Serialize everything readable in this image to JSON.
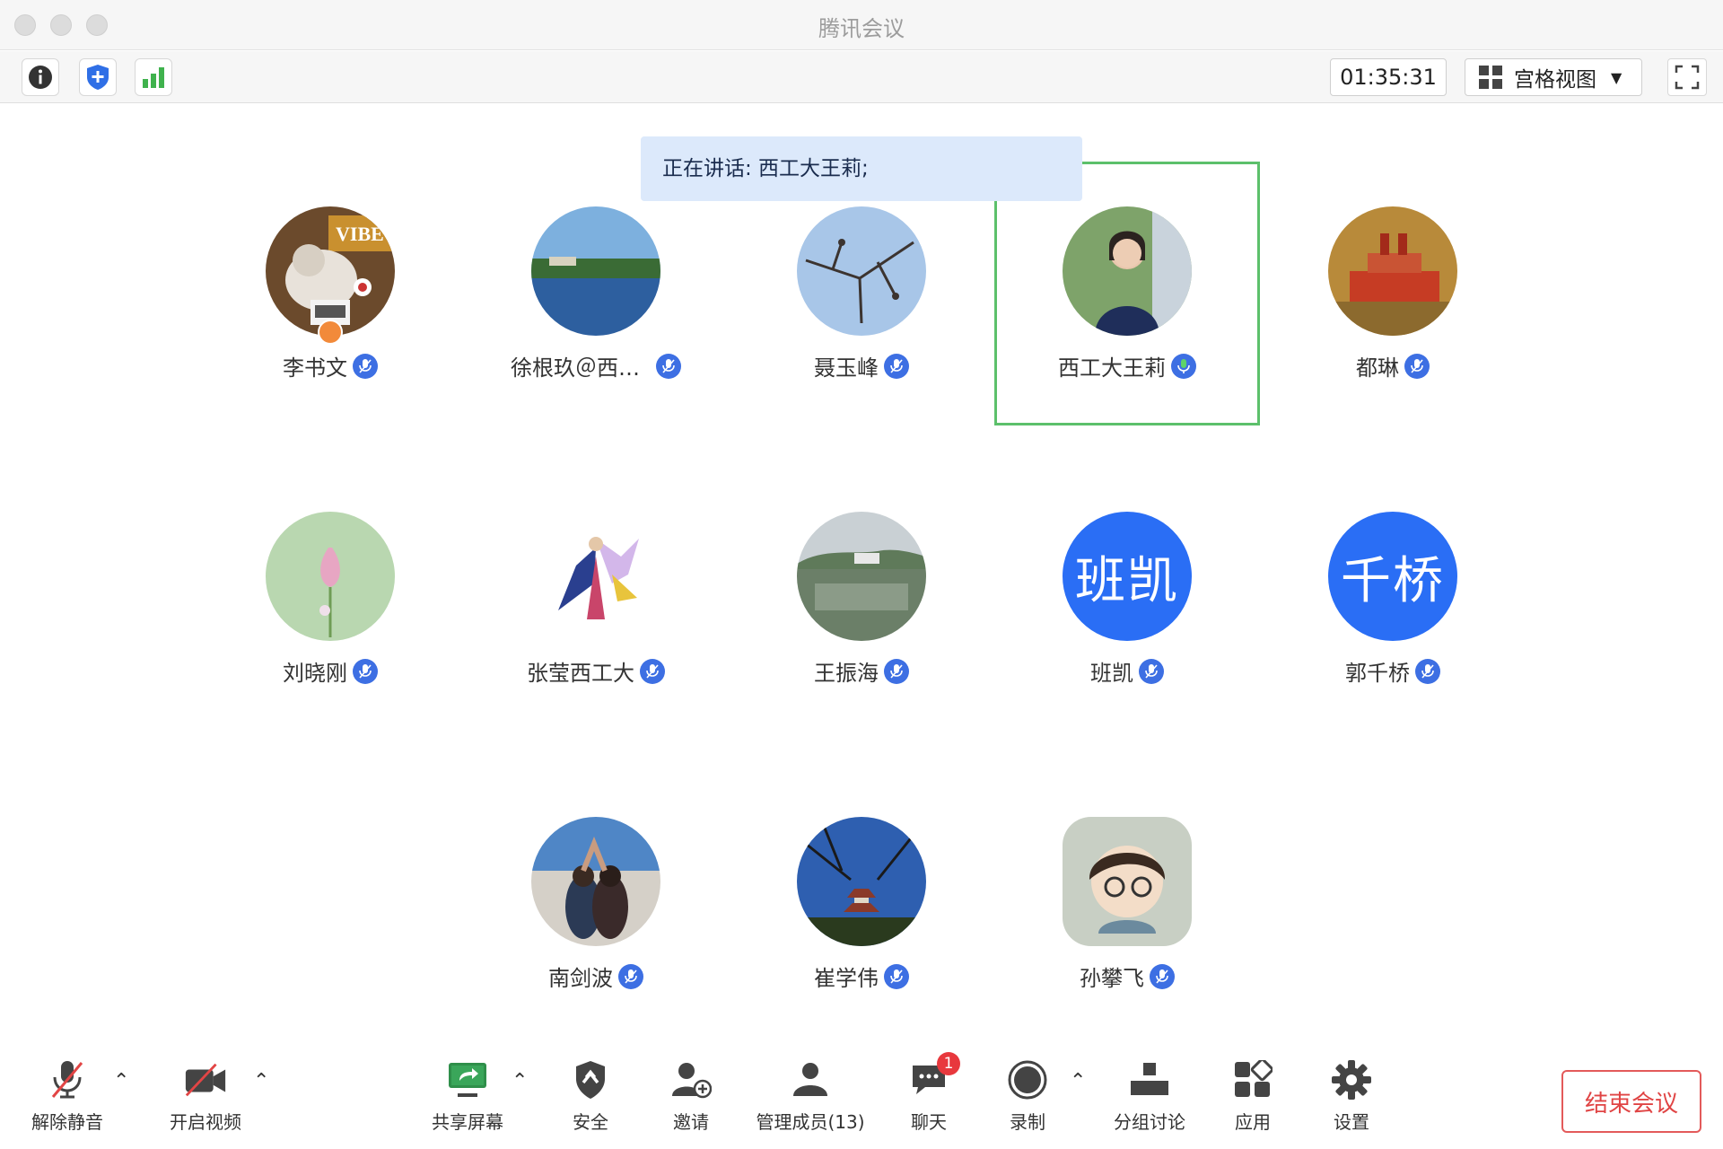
{
  "window": {
    "title": "腾讯会议"
  },
  "toolbar": {
    "timer": "01:35:31",
    "view_mode": "宫格视图"
  },
  "banner": {
    "speaking_text": "正在讲话: 西工大王莉;"
  },
  "participants": [
    {
      "name": "李书文",
      "avatar": "photo-cat",
      "host": true,
      "speaking": false
    },
    {
      "name": "徐根玖＠西…",
      "avatar": "photo-lake",
      "host": false,
      "speaking": false
    },
    {
      "name": "聂玉峰",
      "avatar": "photo-branches",
      "host": false,
      "speaking": false
    },
    {
      "name": "西工大王莉",
      "avatar": "photo-woman",
      "host": false,
      "speaking": true
    },
    {
      "name": "都琳",
      "avatar": "photo-ship",
      "host": false,
      "speaking": false
    },
    {
      "name": "刘晓刚",
      "avatar": "photo-flower",
      "host": false,
      "speaking": false
    },
    {
      "name": "张莹西工大",
      "avatar": "photo-art",
      "host": false,
      "speaking": false
    },
    {
      "name": "王振海",
      "avatar": "photo-pond",
      "host": false,
      "speaking": false
    },
    {
      "name": "班凯",
      "avatar": "initials",
      "initials": "班凯",
      "host": false,
      "speaking": false
    },
    {
      "name": "郭千桥",
      "avatar": "initials",
      "initials": "千桥",
      "host": false,
      "speaking": false
    },
    {
      "name": "南剑波",
      "avatar": "photo-couple",
      "host": false,
      "speaking": false
    },
    {
      "name": "崔学伟",
      "avatar": "photo-pagoda",
      "host": false,
      "speaking": false
    },
    {
      "name": "孙攀飞",
      "avatar": "photo-cartoon",
      "host": false,
      "speaking": false
    }
  ],
  "bottombar": {
    "unmute": "解除静音",
    "video": "开启视频",
    "share": "共享屏幕",
    "security": "安全",
    "invite": "邀请",
    "members": "管理成员(13)",
    "chat": "聊天",
    "chat_badge": "1",
    "record": "录制",
    "breakout": "分组讨论",
    "apps": "应用",
    "settings": "设置",
    "end": "结束会议"
  },
  "colors": {
    "accent_blue": "#2a6ef5",
    "speaking_green": "#5cc06b",
    "end_red": "#e04444",
    "banner_bg": "#dce9fb"
  }
}
